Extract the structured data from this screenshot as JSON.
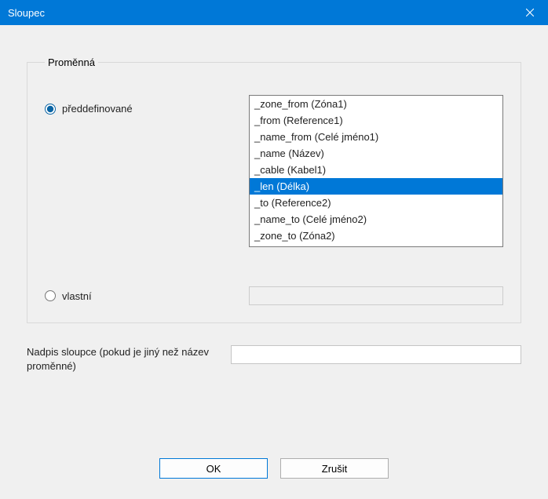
{
  "titlebar": {
    "title": "Sloupec"
  },
  "groupbox": {
    "legend": "Proměnná",
    "radio_predefined_label": "předdefinované",
    "radio_custom_label": "vlastní",
    "radio_selected": "predefined",
    "list": {
      "items": [
        "_zone_from (Zóna1)",
        "_from (Reference1)",
        "_name_from (Celé jméno1)",
        "_name (Název)",
        "_cable (Kabel1)",
        "_len (Délka)",
        "_to (Reference2)",
        "_name_to (Celé jméno2)",
        "_zone_to (Zóna2)"
      ],
      "selected_index": 5
    },
    "custom_input_value": ""
  },
  "caption": {
    "label": "Nadpis sloupce (pokud je jiný než název proměnné)",
    "value": ""
  },
  "buttons": {
    "ok": "OK",
    "cancel": "Zrušit"
  }
}
